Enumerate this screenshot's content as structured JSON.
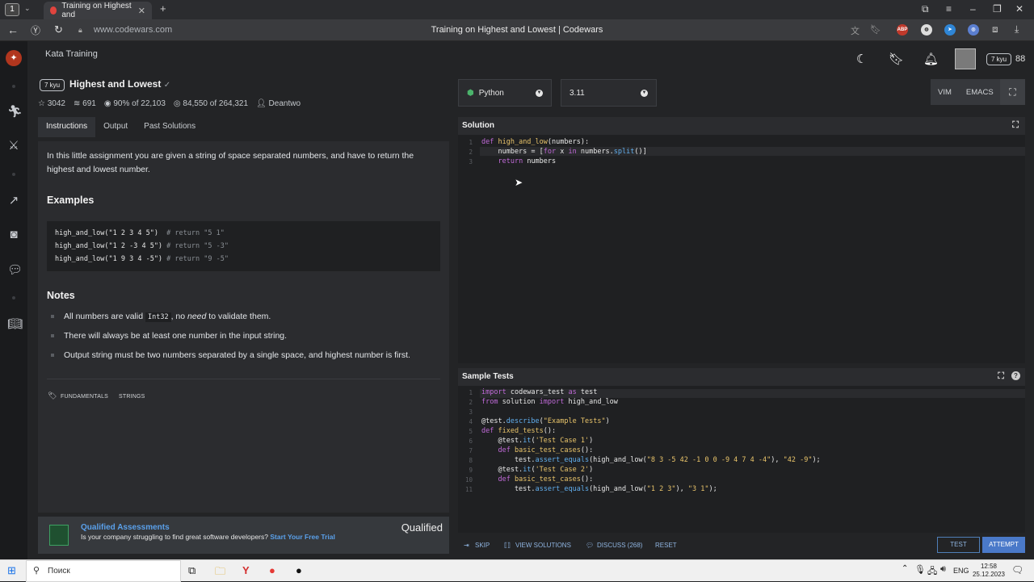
{
  "browser": {
    "tab_count": "1",
    "tab_title": "Training on Highest and",
    "url": "www.codewars.com",
    "page_title": "Training on Highest and Lowest | Codewars",
    "ext_abp": "ABP"
  },
  "header": {
    "section": "Kata Training",
    "user_rank": "7 kyu",
    "honor": "88"
  },
  "kata": {
    "rank": "7 kyu",
    "name": "Highest and Lowest",
    "stars": "3042",
    "collections": "691",
    "satisfaction_pct": "90%",
    "satisfaction_of": "of 22,103",
    "completed": "84,550",
    "completed_of": "of 264,321",
    "author": "Deantwo"
  },
  "tabs": [
    "Instructions",
    "Output",
    "Past Solutions"
  ],
  "instructions": {
    "intro": "In this little assignment you are given a string of space separated numbers, and have to return the highest and lowest number.",
    "examples_heading": "Examples",
    "examples": [
      {
        "code": "high_and_low(\"1 2 3 4 5\")  ",
        "comment": "# return \"5 1\""
      },
      {
        "code": "high_and_low(\"1 2 -3 4 5\") ",
        "comment": "# return \"5 -3\""
      },
      {
        "code": "high_and_low(\"1 9 3 4 -5\") ",
        "comment": "# return \"9 -5\""
      }
    ],
    "notes_heading": "Notes",
    "note1_pre": "All numbers are valid ",
    "note1_code": "Int32",
    "note1_mid": ", no ",
    "note1_em": "need",
    "note1_post": " to validate them.",
    "note2": "There will always be at least one number in the input string.",
    "note3": "Output string must be two numbers separated by a single space, and highest number is first.",
    "tags": [
      "FUNDAMENTALS",
      "STRINGS"
    ]
  },
  "promo": {
    "title": "Qualified Assessments",
    "text": "Is your company struggling to find great software developers?",
    "cta": "Start Your Free Trial",
    "brand": "Qualified"
  },
  "editor": {
    "language": "Python",
    "version": "3.11",
    "modes": [
      "VIM",
      "EMACS"
    ],
    "solution_title": "Solution",
    "tests_title": "Sample Tests"
  },
  "actions": {
    "skip": "SKIP",
    "view_solutions": "VIEW SOLUTIONS",
    "discuss": "DISCUSS (268)",
    "reset": "RESET",
    "test": "TEST",
    "attempt": "ATTEMPT"
  },
  "taskbar": {
    "search": "Поиск",
    "lang": "ENG",
    "time": "12:58",
    "date": "25.12.2023"
  },
  "colors": {
    "accent": "#4a79c9",
    "brand_red": "#e0443e",
    "background": "#232426"
  }
}
